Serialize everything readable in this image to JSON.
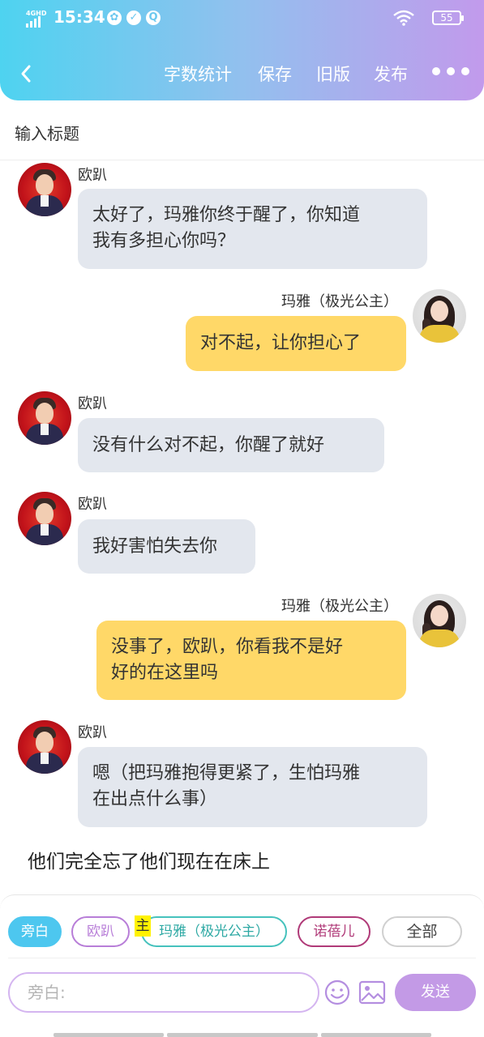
{
  "status_bar": {
    "network": "4GHD",
    "time": "15:34",
    "battery": "55",
    "app_icons": [
      "pinwheel-icon",
      "check-circle-icon",
      "q-icon"
    ]
  },
  "toolbar": {
    "back_icon": "chevron-left-icon",
    "word_count": "字数统计",
    "save": "保存",
    "old_version": "旧版",
    "publish": "发布",
    "more_icon": "more-dots-icon"
  },
  "title_input": {
    "placeholder": "输入标题"
  },
  "messages": [
    {
      "speaker": "欧趴",
      "side": "left",
      "lines": [
        "太好了，玛雅你终于醒了，你知道",
        "我有多担心你吗？"
      ]
    },
    {
      "speaker": "玛雅（极光公主）",
      "side": "right",
      "lines": [
        "对不起，让你担心了"
      ]
    },
    {
      "speaker": "欧趴",
      "side": "left",
      "lines": [
        "没有什么对不起，你醒了就好"
      ]
    },
    {
      "speaker": "欧趴",
      "side": "left",
      "lines": [
        "我好害怕失去你"
      ]
    },
    {
      "speaker": "玛雅（极光公主）",
      "side": "right",
      "lines": [
        "没事了，欧趴，你看我不是好",
        "好的在这里吗"
      ]
    },
    {
      "speaker": "欧趴",
      "side": "left",
      "lines": [
        "嗯（把玛雅抱得更紧了，生怕玛雅",
        "在出点什么事）"
      ]
    }
  ],
  "narration": "他们完全忘了他们现在在床上",
  "role_chips": [
    {
      "label": "旁白",
      "selected": true
    },
    {
      "label": "欧趴",
      "selected": false
    },
    {
      "label": "玛雅（极光公主）",
      "selected": false
    },
    {
      "label": "诺蓓儿",
      "selected": false
    },
    {
      "label": "全部",
      "selected": false
    }
  ],
  "highlight_char": "主",
  "composer": {
    "placeholder": "旁白:",
    "emoji_icon": "smiley-icon",
    "image_icon": "image-icon",
    "send": "发送"
  },
  "colors": {
    "header_gradient": [
      "#4ed3f0",
      "#c29aec"
    ],
    "left_bubble": "#e3e7ee",
    "right_bubble": "#ffd868",
    "send_button": "#c39ae6",
    "chip_narration": "#4dc7ef",
    "chip_opa": "#b87ed8",
    "chip_maya": "#46c2bd",
    "chip_nobel": "#b03a78",
    "chip_all": "#d0d0d0"
  }
}
